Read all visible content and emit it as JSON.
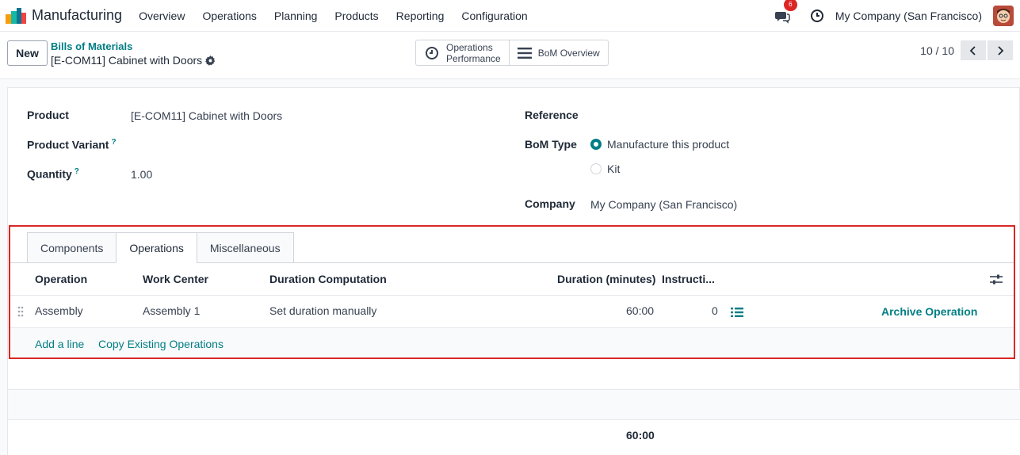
{
  "nav": {
    "app_name": "Manufacturing",
    "menu": [
      "Overview",
      "Operations",
      "Planning",
      "Products",
      "Reporting",
      "Configuration"
    ],
    "chat_badge": "6",
    "company": "My Company (San Francisco)"
  },
  "control": {
    "new_label": "New",
    "breadcrumb_parent": "Bills of Materials",
    "breadcrumb_current": "[E-COM11] Cabinet with Doors",
    "smart_ops_line1": "Operations",
    "smart_ops_line2": "Performance",
    "smart_bom": "BoM Overview",
    "pager": "10 / 10"
  },
  "form": {
    "product_label": "Product",
    "product_value": "[E-COM11] Cabinet with Doors",
    "variant_label": "Product Variant",
    "quantity_label": "Quantity",
    "quantity_value": "1.00",
    "help_mark": "?",
    "reference_label": "Reference",
    "bom_type_label": "BoM Type",
    "bom_type_options": [
      "Manufacture this product",
      "Kit"
    ],
    "bom_type_selected": "Manufacture this product",
    "company_label": "Company",
    "company_value": "My Company (San Francisco)"
  },
  "tabs": [
    "Components",
    "Operations",
    "Miscellaneous"
  ],
  "active_tab": "Operations",
  "table": {
    "headers": [
      "Operation",
      "Work Center",
      "Duration Computation",
      "Duration (minutes)",
      "Instructi..."
    ],
    "rows": [
      {
        "operation": "Assembly",
        "work_center": "Assembly 1",
        "duration_computation": "Set duration manually",
        "duration": "60:00",
        "instructions": "0",
        "action": "Archive Operation"
      }
    ],
    "add_line": "Add a line",
    "copy_ops": "Copy Existing Operations",
    "total": "60:00"
  },
  "colors": {
    "accent": "#017e84",
    "highlight": "#dc2626",
    "badge": "#dc2626"
  }
}
